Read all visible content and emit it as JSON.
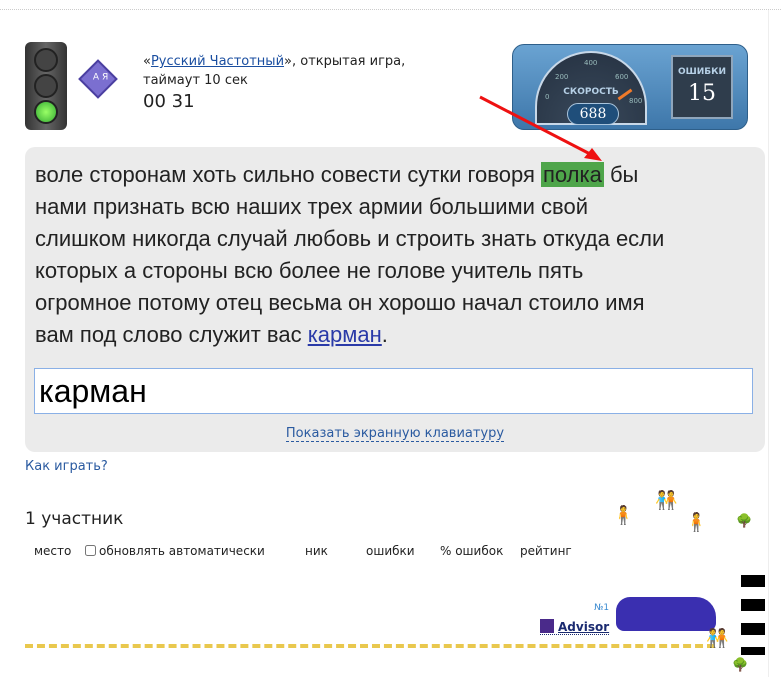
{
  "game": {
    "type_link": "Русский Частотный",
    "quote_open": "«",
    "quote_close": "»",
    "type_rest": ", открытая игра,",
    "timeout": "таймаут 10 сек",
    "timer": "00 31"
  },
  "dashboard": {
    "speed_label": "СКОРОСТЬ",
    "speed": "688",
    "errors_label": "ОШИБКИ",
    "errors": "15",
    "speed_ticks": [
      "0",
      "200",
      "400",
      "600",
      "800"
    ]
  },
  "text": {
    "line1_before": "воле сторонам хоть сильно совести сутки говоря ",
    "highlight": "полка",
    "line1_after": " бы",
    "line2": "нами признать всю наших трех армии большими свой",
    "line3": "слишком никогда случай любовь и строить знать откуда если",
    "line4": "которых а стороны всю более не голове учитель пять",
    "line5": "огромное потому отец весьма он хорошо начал стоило имя",
    "line6_before": "вам под слово служит вас ",
    "link": "карман",
    "line6_after": "."
  },
  "input": {
    "value": "карман"
  },
  "keyboard_link": "Показать экранную клавиатуру",
  "how_to_play": "Как играть?",
  "participants": "1 участник",
  "table": {
    "place": "место",
    "auto_update": "обновлять автоматически",
    "nick": "ник",
    "errors": "ошибки",
    "error_pct": "% ошибок",
    "rating": "рейтинг"
  },
  "player": {
    "rank": "№1",
    "nick": "Advisor"
  },
  "colors": {
    "highlight": "#4ea54a",
    "link": "#2a3aa8",
    "road": "#e9c84e"
  }
}
